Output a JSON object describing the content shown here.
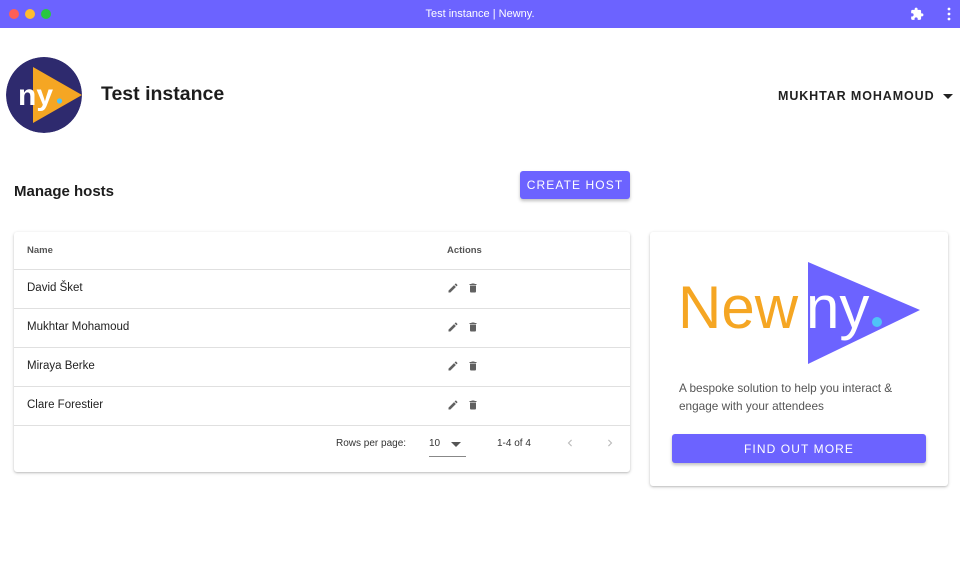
{
  "window": {
    "title": "Test instance | Newny.",
    "extension_icon": "puzzle-icon",
    "menu_icon": "kebab-menu-icon"
  },
  "header": {
    "logo_text": "ny",
    "instance_title": "Test instance",
    "user_name": "MUKHTAR MOHAMOUD"
  },
  "hosts": {
    "section_title": "Manage hosts",
    "create_label": "CREATE HOST",
    "columns": {
      "name": "Name",
      "actions": "Actions"
    },
    "rows": [
      {
        "name": "David Šket"
      },
      {
        "name": "Mukhtar Mohamoud"
      },
      {
        "name": "Miraya Berke"
      },
      {
        "name": "Clare Forestier"
      }
    ],
    "pagination": {
      "rows_per_page_label": "Rows per page:",
      "rows_per_page_value": "10",
      "range": "1-4 of 4"
    }
  },
  "promo": {
    "logo_part1": "New",
    "logo_part2": "ny",
    "description": "A bespoke solution to help you interact & engage with your attendees",
    "cta_label": "FIND OUT MORE"
  },
  "colors": {
    "accent": "#6c63ff",
    "logo_yellow": "#f5a623",
    "logo_navy": "#2e2a6e",
    "logo_dot": "#4fc3f7"
  }
}
